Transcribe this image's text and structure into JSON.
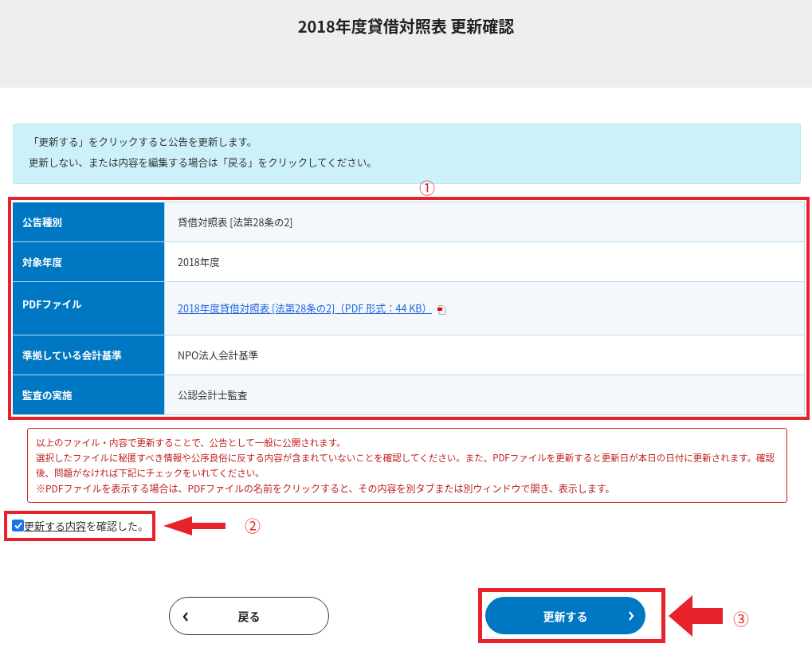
{
  "header": {
    "title": "2018年度貸借対照表 更新確認"
  },
  "info": [
    "「更新する」をクリックすると公告を更新します。",
    "更新しない、または内容を編集する場合は「戻る」をクリックしてください。"
  ],
  "markers": [
    "①",
    "②",
    "③"
  ],
  "table": {
    "rows": [
      {
        "label": "公告種別",
        "value": "貸借対照表 [法第28条の2]",
        "kind": "text"
      },
      {
        "label": "対象年度",
        "value": "2018年度",
        "kind": "text"
      },
      {
        "label": "PDFファイル",
        "value": "2018年度貸借対照表 [法第28条の2]（PDF 形式：44 KB）",
        "kind": "file"
      },
      {
        "label": "準拠している会計基準",
        "value": "NPO法人会計基準",
        "kind": "text"
      },
      {
        "label": "監査の実施",
        "value": "公認会計士監査",
        "kind": "text"
      }
    ]
  },
  "notice": {
    "lines": [
      "以上のファイル・内容で更新することで、公告として一般に公開されます。",
      "選択したファイルに秘匿すべき情報や公序良俗に反する内容が含まれていないことを確認してください。また、PDFファイルを更新すると更新日が本日の日付に更新されます。確認後、問題がなければ下記にチェックをいれてください。"
    ],
    "note": "※PDFファイルを表示する場合は、PDFファイルの名前をクリックすると、その内容を別タブまたは別ウィンドウで開き、表示します。"
  },
  "confirm": {
    "link": "更新する内容",
    "text": "を確認した。",
    "checked": true
  },
  "buttons": {
    "back": "戻る",
    "submit": "更新する"
  }
}
